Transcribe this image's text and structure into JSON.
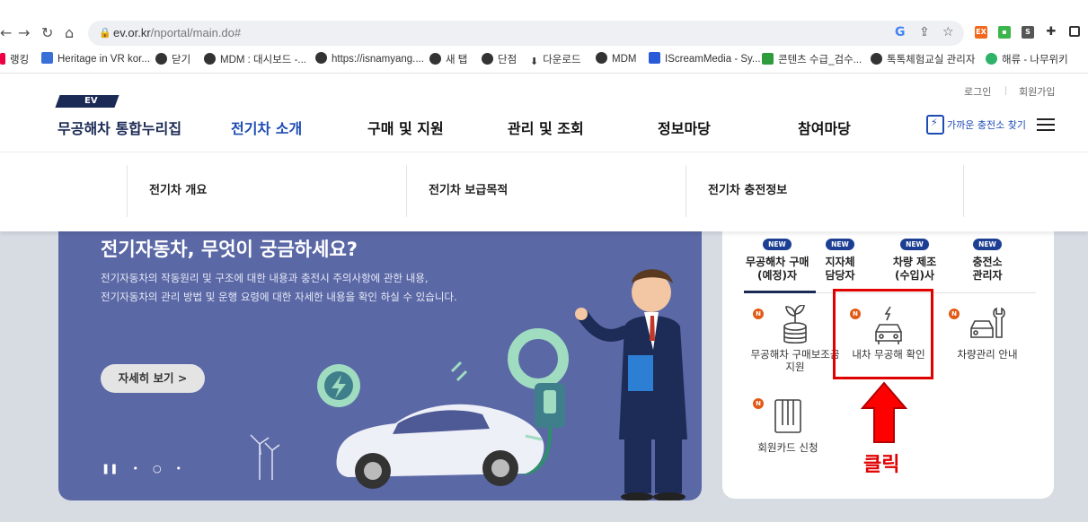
{
  "browser": {
    "url_host": "ev.or.kr",
    "url_path": "/nportal/main.do#",
    "bookmarks": [
      {
        "label": "랭킹"
      },
      {
        "label": "Heritage in VR kor..."
      },
      {
        "label": "닫기"
      },
      {
        "label": "MDM : 대시보드 -..."
      },
      {
        "label": "https://isnamyang...."
      },
      {
        "label": "새 탭"
      },
      {
        "label": "단점"
      },
      {
        "label": "다운로드"
      },
      {
        "label": "MDM"
      },
      {
        "label": "IScreamMedia - Sy..."
      },
      {
        "label": "콘텐츠 수급_검수..."
      },
      {
        "label": "톡톡체험교실 관리자"
      },
      {
        "label": "해류 - 나무위키"
      }
    ]
  },
  "site": {
    "logo_badge": "EV",
    "logo_text": "무공해차 통합누리집",
    "gnb": [
      "전기차 소개",
      "구매 및 지원",
      "관리 및 조회",
      "정보마당",
      "참여마당"
    ],
    "login": "로그인",
    "signup": "회원가입",
    "charge_find": "가까운 충전소 찾기",
    "submenu": [
      "전기차 개요",
      "전기차 보급목적",
      "전기차 충전정보"
    ]
  },
  "banner": {
    "title": "전기자동차, 무엇이 궁금하세요?",
    "desc_line1": "전기자동차의 작동원리 및 구조에 대한 내용과 충전시 주의사항에 관한 내용,",
    "desc_line2": "전기자동차의 관리 방법 및 운행 요령에 대한 자세한 내용을 확인 하실 수 있습니다.",
    "button": "자세히 보기 >"
  },
  "panel": {
    "new_label": "NEW",
    "tabs": [
      {
        "line1": "무공해차 구매",
        "line2": "(예정)자"
      },
      {
        "line1": "지자체",
        "line2": "담당자"
      },
      {
        "line1": "차량 제조",
        "line2": "(수입)사"
      },
      {
        "line1": "충전소",
        "line2": "관리자"
      }
    ],
    "n_label": "N",
    "services": [
      {
        "line1": "무공해차 구매보조금",
        "line2": "지원"
      },
      {
        "line1": "내차 무공해 확인",
        "line2": ""
      },
      {
        "line1": "차량관리 안내",
        "line2": ""
      },
      {
        "line1": "회원카드 신청",
        "line2": ""
      }
    ]
  },
  "annotation": {
    "click_label": "클릭",
    "color": "#e00000"
  }
}
